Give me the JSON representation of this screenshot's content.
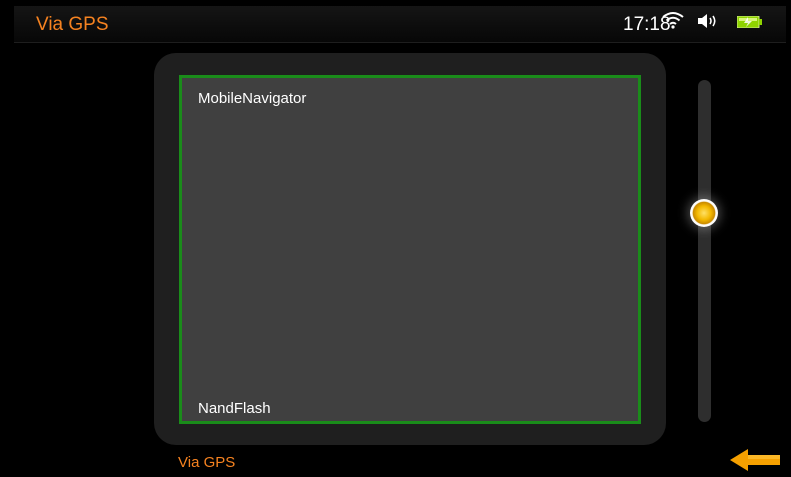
{
  "header": {
    "title": "Via GPS",
    "time": "17:18",
    "icons": [
      "wifi-icon",
      "speaker-icon",
      "battery-icon"
    ]
  },
  "file_list": {
    "items": [
      {
        "label": "MobileNavigator"
      },
      {
        "label": "NandFlash"
      }
    ]
  },
  "scrollbar": {
    "position_fraction": 0.38
  },
  "footer": {
    "title": "Via GPS",
    "back_icon": "back-arrow-icon"
  },
  "colors": {
    "accent": "#f58220",
    "selection_border": "#1a8c1a",
    "list_bg": "#404040",
    "panel_bg": "#1f1f1f"
  }
}
